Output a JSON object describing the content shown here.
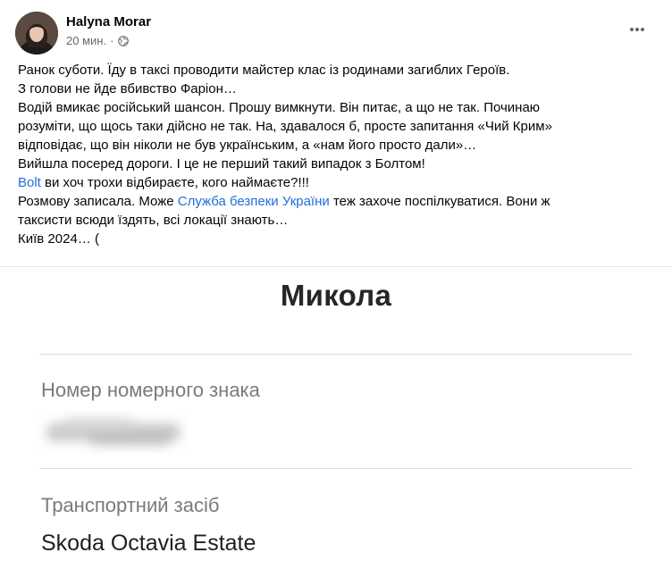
{
  "post": {
    "author": "Halyna Morar",
    "time": "20 мин.",
    "separator": "·",
    "privacy_icon": "globe-icon",
    "menu_icon": "more-dots-icon",
    "lines": [
      [
        {
          "t": "Ранок суботи. Їду в таксі проводити майстер клас із родинами загиблих Героїв."
        }
      ],
      [
        {
          "t": "З голови не йде вбивство Фаріон…"
        }
      ],
      [
        {
          "t": "Водій вмикає російський шансон. Прошу вимкнути. Він питає, а що не так. Починаю"
        }
      ],
      [
        {
          "t": "розуміти, що щось таки дійсно не так. На, здавалося б, просте запитання «Чий Крим»"
        }
      ],
      [
        {
          "t": "відповідає, що він ніколи не був українським, а «нам його просто дали»…"
        }
      ],
      [
        {
          "t": "Вийшла посеред дороги. І це не перший такий випадок з Болтом!"
        }
      ],
      [
        {
          "t": "Bolt",
          "link": true
        },
        {
          "t": " ви хоч трохи відбираєте, кого наймаєте?!!!"
        }
      ],
      [
        {
          "t": "Розмову записала. Може "
        },
        {
          "t": "Служба безпеки України",
          "link": true
        },
        {
          "t": " теж захоче поспілкуватися. Вони ж"
        }
      ],
      [
        {
          "t": "таксисти всюди їздять, всі локації знають…"
        }
      ],
      [
        {
          "t": "Київ 2024… ("
        }
      ]
    ]
  },
  "screenshot": {
    "driver_name": "Микола",
    "plate_label": "Номер номерного знака",
    "vehicle_label": "Транспортний засіб",
    "vehicle_value": "Skoda Octavia Estate"
  },
  "colors": {
    "link": "#216fdb",
    "meta": "#65676b",
    "label": "#7a7a7a"
  }
}
